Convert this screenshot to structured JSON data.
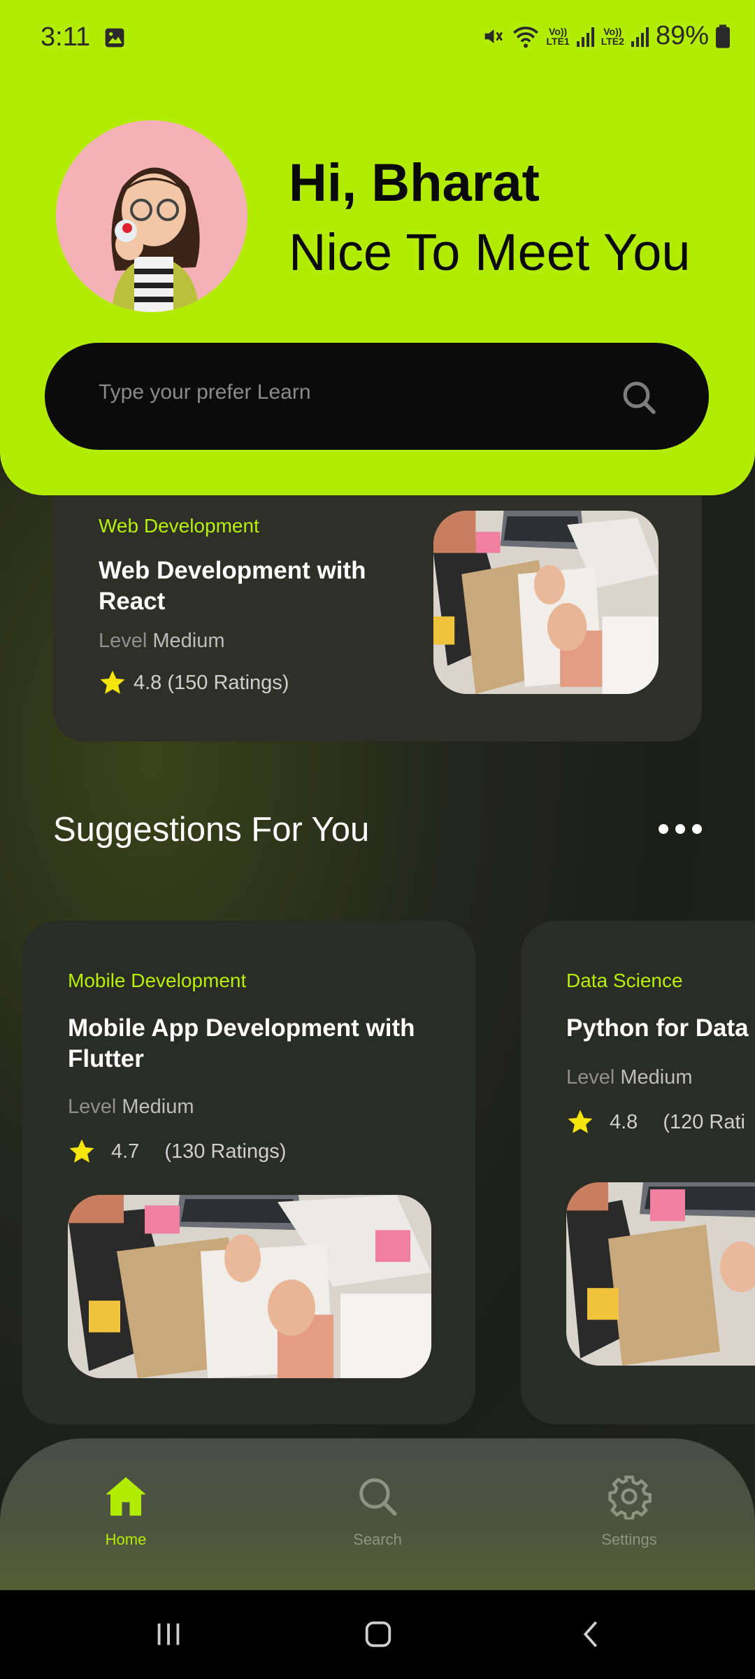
{
  "status_bar": {
    "time": "3:11",
    "net1": "Vo))\nLTE1",
    "net1_top": "Vo))",
    "net1_bottom": "LTE1",
    "net2_top": "Vo))",
    "net2_bottom": "LTE2",
    "battery": "89%"
  },
  "header": {
    "greeting": "Hi, Bharat",
    "subtitle": "Nice To Meet You",
    "search_placeholder": "Type your prefer Learn"
  },
  "featured_course": {
    "category": "Web Development",
    "title": "Web Development with React",
    "level_label": "Level",
    "level_value": "Medium",
    "rating": "4.8 (150 Ratings)"
  },
  "suggestions": {
    "title": "Suggestions For You",
    "cards": [
      {
        "category": "Mobile Development",
        "title": "Mobile App Development with Flutter",
        "level_label": "Level",
        "level_value": "Medium",
        "rating": "4.7",
        "ratings_count": "(130 Ratings)"
      },
      {
        "category": "Data Science",
        "title": "Python for Data",
        "level_label": "Level",
        "level_value": "Medium",
        "rating": "4.8",
        "ratings_count": "(120 Rati"
      }
    ]
  },
  "bottom_nav": {
    "items": [
      {
        "label": "Home",
        "active": true
      },
      {
        "label": "Search",
        "active": false
      },
      {
        "label": "Settings",
        "active": false
      }
    ]
  },
  "colors": {
    "accent": "#b3ec03",
    "accent_text": "#b8ef0a",
    "star": "#f5e50c",
    "nav_inactive": "#8f9482"
  }
}
